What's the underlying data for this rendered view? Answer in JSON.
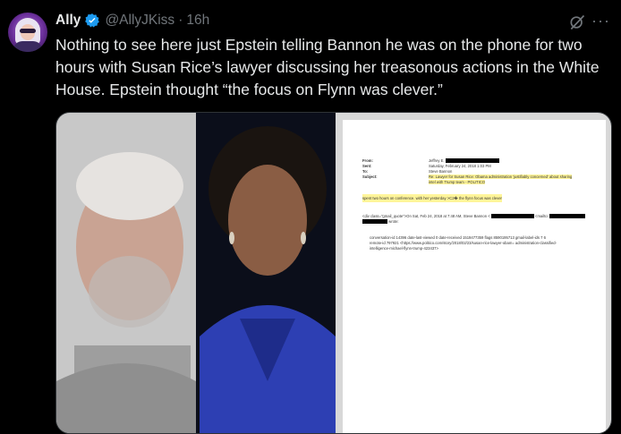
{
  "author": {
    "name": "Ally",
    "handle": "@AllyJKiss",
    "separator": "·",
    "time": "16h"
  },
  "tweet": {
    "text": "Nothing to see here just Epstein telling Bannon he was on the phone for two hours with Susan Rice’s lawyer discussing her treasonous actions in the White House. Epstein thought “the focus on Flynn was clever.”"
  },
  "icons": {
    "verified": "verified-badge-icon",
    "grok": "grok-icon",
    "more": "more-icon"
  },
  "colors": {
    "background": "#000000",
    "text": "#e7e9ea",
    "secondary": "#71767b",
    "verified": "#1d9bf0"
  },
  "document": {
    "from_label": "From:",
    "from_value": "Jeffrey E.",
    "sent_label": "Sent:",
    "sent_value": "Saturday, February 24, 2018 1:03 PM",
    "to_label": "To:",
    "to_value": "Steve Bannon",
    "subject_label": "Subject:",
    "subject_line1": "Re: Lawyer for Susan Rice: Obama administration 'justifiably concerned' about sharing",
    "subject_line2": "intel with Trump team - POLITICO",
    "body_line": "spent two hours  on conference. with her yesterday >C2� the flynn focus was clever",
    "quote_line1": "<div class=\"gmail_quote\">On Sat, Feb 24, 2018 at 7:48 AM, Steve Bannon <",
    "quote_mailto": "<mailto:",
    "quote_wrote": "wrote:",
    "meta_line1": "conversation-id 14396 date-last-viewed 0 date-received 1519477359 flags 8590195713 gmail-label-ids 7 6",
    "meta_line2": "remote-id 797921 <https://www.politico.com/story/2018/02/23/susan-rice-lawyer-obam= administration-classified-",
    "meta_line3": "intelligence-michael-flynn-trump-423437>"
  }
}
